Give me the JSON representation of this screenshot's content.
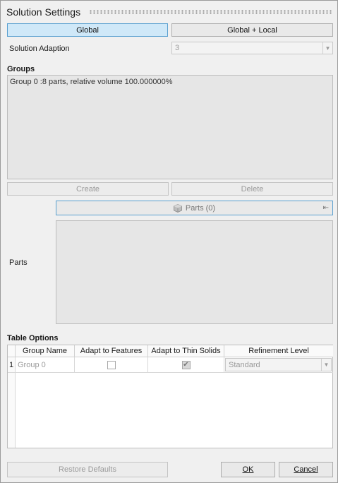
{
  "title": "Solution Settings",
  "mode_tabs": {
    "global": "Global",
    "global_local": "Global + Local"
  },
  "solution_adaption": {
    "label": "Solution Adaption",
    "value": "3"
  },
  "groups": {
    "heading": "Groups",
    "items": [
      "Group 0 :8 parts, relative volume 100.000000%"
    ],
    "create": "Create",
    "delete": "Delete"
  },
  "parts": {
    "label": "Parts",
    "selector": "Parts (0)"
  },
  "table_options": {
    "heading": "Table Options",
    "columns": [
      "Group Name",
      "Adapt to Features",
      "Adapt to Thin Solids",
      "Refinement Level"
    ],
    "rows": [
      {
        "index": "1",
        "group_name": "Group 0",
        "adapt_to_features": false,
        "adapt_to_thin_solids": true,
        "refinement_level": "Standard"
      }
    ]
  },
  "footer": {
    "restore_defaults": "Restore Defaults",
    "ok": "OK",
    "cancel": "Cancel"
  }
}
